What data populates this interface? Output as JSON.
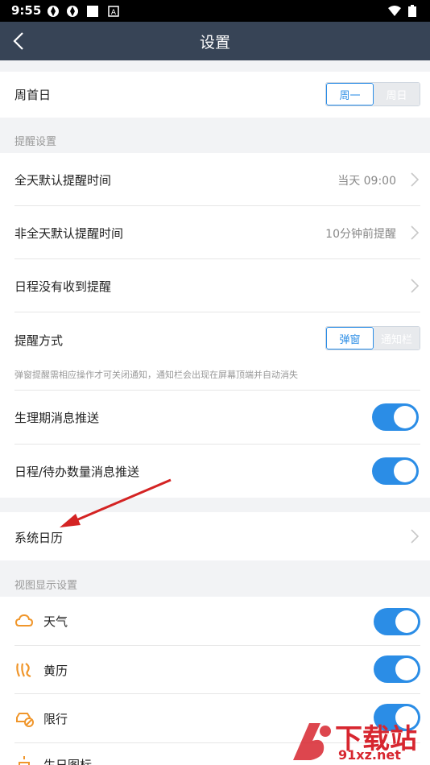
{
  "status_bar": {
    "time": "9:55"
  },
  "nav": {
    "title": "设置"
  },
  "week_start": {
    "label": "周首日",
    "options": [
      "周一",
      "周日"
    ],
    "selected": "周一"
  },
  "reminder_section": {
    "title": "提醒设置",
    "allday": {
      "label": "全天默认提醒时间",
      "value": "当天 09:00"
    },
    "nonallday": {
      "label": "非全天默认提醒时间",
      "value": "10分钟前提醒"
    },
    "not_received": {
      "label": "日程没有收到提醒"
    },
    "method": {
      "label": "提醒方式",
      "options": [
        "弹窗",
        "通知栏"
      ],
      "selected": "弹窗"
    },
    "hint": "弹窗提醒需相应操作才可关闭通知，通知栏会出现在屏幕顶端并自动消失",
    "period_push": {
      "label": "生理期消息推送",
      "on": true
    },
    "count_push": {
      "label": "日程/待办数量消息推送",
      "on": true
    }
  },
  "system_calendar": {
    "label": "系统日历"
  },
  "view_section": {
    "title": "视图显示设置",
    "items": [
      {
        "label": "天气",
        "icon": "weather-cloud-icon",
        "on": true
      },
      {
        "label": "黄历",
        "icon": "almanac-icon",
        "on": true
      },
      {
        "label": "限行",
        "icon": "car-restriction-icon",
        "on": true
      },
      {
        "label": "生日图标",
        "icon": "birthday-icon",
        "on": true
      }
    ]
  },
  "watermark": {
    "big": "下载站",
    "small": "91xz.net"
  },
  "colors": {
    "accent": "#2b8de6",
    "navbar": "#374456",
    "icon_orange": "#f0962b",
    "arrow_red": "#d42323"
  }
}
